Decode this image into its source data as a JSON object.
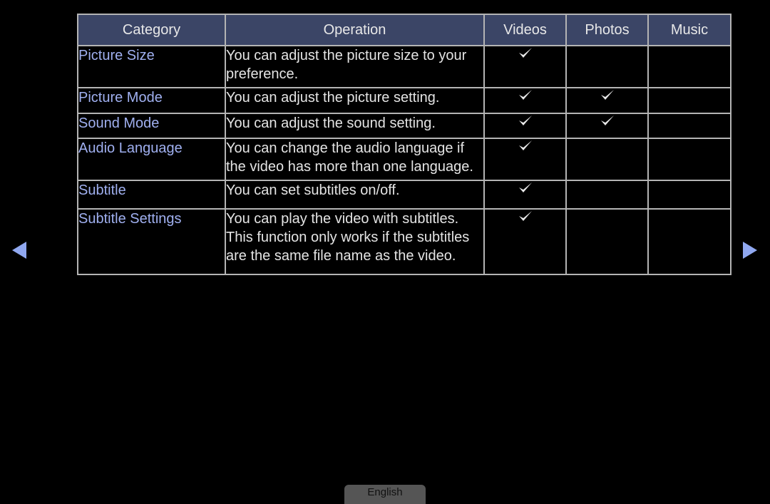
{
  "table": {
    "headers": [
      "Category",
      "Operation",
      "Videos",
      "Photos",
      "Music"
    ],
    "rows": [
      {
        "category": "Picture Size",
        "operation": "You can adjust the picture size to your preference.",
        "videos": true,
        "photos": false,
        "music": false
      },
      {
        "category": "Picture Mode",
        "operation": "You can adjust the picture setting.",
        "videos": true,
        "photos": true,
        "music": false
      },
      {
        "category": "Sound Mode",
        "operation": "You can adjust the sound setting.",
        "videos": true,
        "photos": true,
        "music": false
      },
      {
        "category": "Audio Language",
        "operation": "You can change the audio language if the video has more than one language.",
        "videos": true,
        "photos": false,
        "music": false
      },
      {
        "category": "Subtitle",
        "operation": "You can set subtitles on/off.",
        "videos": true,
        "photos": false,
        "music": false
      },
      {
        "category": "Subtitle Settings",
        "operation": "You can play the video with subtitles. This function only works if the subtitles are the same file name as the video.",
        "videos": true,
        "photos": false,
        "music": false
      }
    ]
  },
  "nav": {
    "prev_icon": "triangle-left",
    "next_icon": "triangle-right"
  },
  "language_tab": "English",
  "colors": {
    "header_bg": "#3b4566",
    "category_text": "#a0b0f0",
    "arrow": "#90a8f0",
    "border": "#b4b4b4"
  }
}
